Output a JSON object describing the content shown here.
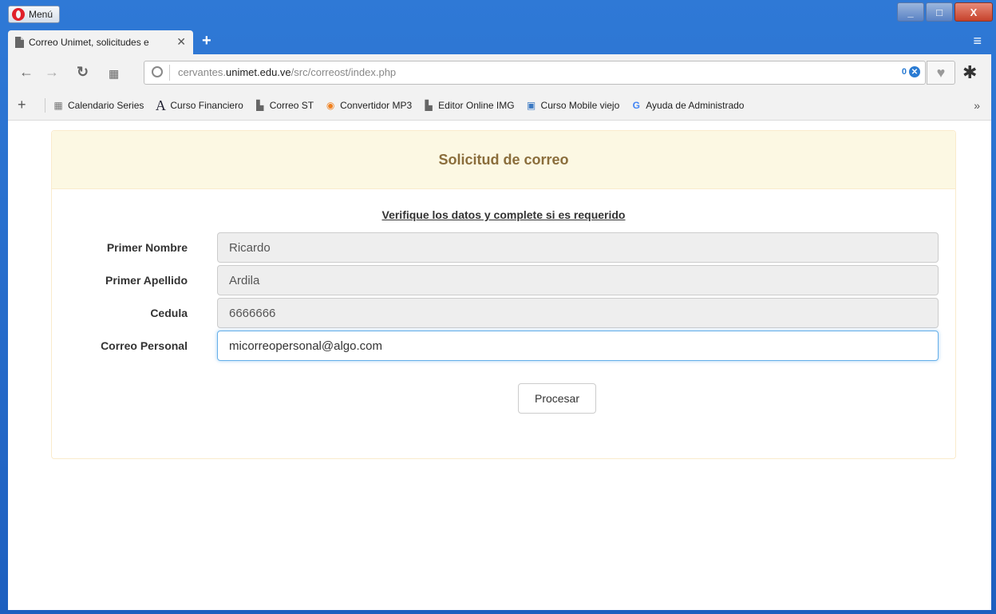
{
  "window": {
    "menu_label": "Menú",
    "minimize": "_",
    "maximize": "□",
    "close": "X"
  },
  "tab": {
    "title": "Correo Unimet, solicitudes e",
    "close": "✕"
  },
  "address": {
    "url_prefix": "cervantes.",
    "url_domain": "unimet.edu.ve",
    "url_path": "/src/correost/index.php",
    "adblock_count": "0"
  },
  "bookmarks": [
    {
      "label": "Calendario Series",
      "icon": "grid-icon"
    },
    {
      "label": "Curso Financiero",
      "icon": "serif-a-icon"
    },
    {
      "label": "Correo ST",
      "icon": "document-icon"
    },
    {
      "label": "Convertidor MP3",
      "icon": "convert-icon"
    },
    {
      "label": "Editor Online IMG",
      "icon": "document-icon"
    },
    {
      "label": "Curso Mobile viejo",
      "icon": "image-icon"
    },
    {
      "label": "Ayuda de Administrado",
      "icon": "google-g-icon"
    }
  ],
  "form": {
    "heading": "Solicitud de correo",
    "subtitle": "Verifique los datos y complete si es requerido",
    "fields": [
      {
        "label": "Primer Nombre",
        "value": "Ricardo"
      },
      {
        "label": "Primer Apellido",
        "value": "Ardila"
      },
      {
        "label": "Cedula",
        "value": "6666666"
      },
      {
        "label": "Correo Personal",
        "value": "micorreopersonal@algo.com"
      }
    ],
    "submit_label": "Procesar"
  },
  "colors": {
    "heading_bg": "#fcf8e3",
    "heading_text": "#8a6d3b",
    "focus_border": "#66afe9",
    "window_blue": "#1f63c4"
  }
}
